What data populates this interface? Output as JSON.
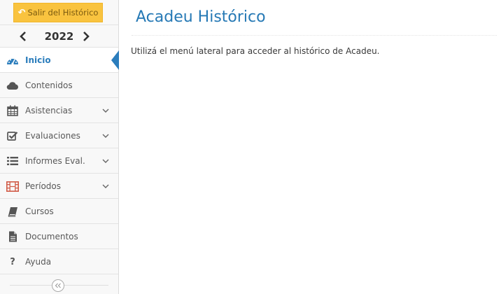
{
  "sidebar": {
    "exit_label": "Salir del Histórico",
    "year": "2022",
    "items": [
      {
        "label": "Inicio"
      },
      {
        "label": "Contenidos"
      },
      {
        "label": "Asistencias"
      },
      {
        "label": "Evaluaciones"
      },
      {
        "label": "Informes Eval."
      },
      {
        "label": "Períodos"
      },
      {
        "label": "Cursos"
      },
      {
        "label": "Documentos"
      },
      {
        "label": "Ayuda"
      }
    ]
  },
  "main": {
    "title": "Acadeu Histórico",
    "message": "Utilizá el menú lateral para acceder al histórico de Acadeu."
  },
  "colors": {
    "accent": "#2b7dbc",
    "exit_button": "#f9c33f",
    "periodos_icon": "#d15b47"
  }
}
